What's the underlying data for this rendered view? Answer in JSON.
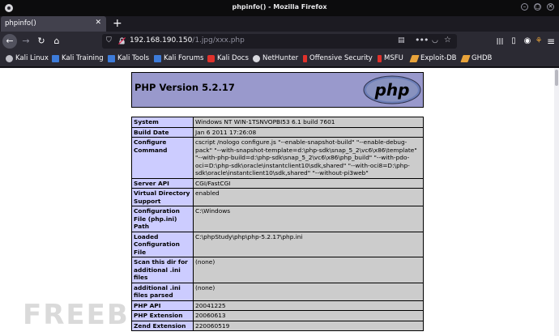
{
  "window": {
    "title": "phpinfo() - Mozilla Firefox",
    "min_glyph": "–",
    "max_glyph": "▢",
    "close_glyph": "✕"
  },
  "tabs": [
    {
      "label": "phpinfo()",
      "close_glyph": "✕"
    }
  ],
  "newtab_glyph": "+",
  "nav": {
    "back_glyph": "←",
    "forward_glyph": "→",
    "reload_glyph": "↻",
    "home_glyph": "⌂",
    "url_host": "192.168.190.150",
    "url_path": "/1.jpg/xxx.php",
    "shield_glyph": "⛉",
    "reader_glyph": "▤",
    "more_glyph": "•••",
    "pocket_glyph": "◡",
    "star_glyph": "☆",
    "library_glyph": "|||",
    "sidebar_glyph": "▯",
    "account_glyph": "◉",
    "extension_glyph": "⚘",
    "menu_glyph": "≡"
  },
  "bookmarks": [
    {
      "label": "Kali Linux",
      "icon": "kali-dragon-icon"
    },
    {
      "label": "Kali Training",
      "icon": "kali-training-icon"
    },
    {
      "label": "Kali Tools",
      "icon": "kali-tools-icon"
    },
    {
      "label": "Kali Forums",
      "icon": "kali-forums-icon"
    },
    {
      "label": "Kali Docs",
      "icon": "kali-docs-icon"
    },
    {
      "label": "NetHunter",
      "icon": "nethunter-icon"
    },
    {
      "label": "Offensive Security",
      "icon": "offsec-icon"
    },
    {
      "label": "MSFU",
      "icon": "msfu-icon"
    },
    {
      "label": "Exploit-DB",
      "icon": "exploit-db-icon"
    },
    {
      "label": "GHDB",
      "icon": "ghdb-icon"
    }
  ],
  "phpinfo": {
    "version": "PHP Version 5.2.17",
    "logo_text": "php",
    "rows": [
      {
        "key": "System",
        "value": "Windows NT WIN-1TSNVOPBI53 6.1 build 7601"
      },
      {
        "key": "Build Date",
        "value": "Jan 6 2011 17:26:08"
      },
      {
        "key": "Configure Command",
        "value": "cscript /nologo configure.js \"--enable-snapshot-build\" \"--enable-debug-pack\" \"--with-snapshot-template=d:\\php-sdk\\snap_5_2\\vc6\\x86\\template\" \"--with-php-build=d:\\php-sdk\\snap_5_2\\vc6\\x86\\php_build\" \"--with-pdo-oci=D:\\php-sdk\\oracle\\instantclient10\\sdk,shared\" \"--with-oci8=D:\\php-sdk\\oracle\\instantclient10\\sdk,shared\" \"--without-pi3web\""
      },
      {
        "key": "Server API",
        "value": "CGI/FastCGI"
      },
      {
        "key": "Virtual Directory Support",
        "value": "enabled"
      },
      {
        "key": "Configuration File (php.ini) Path",
        "value": "C:\\Windows"
      },
      {
        "key": "Loaded Configuration File",
        "value": "C:\\phpStudy\\php\\php-5.2.17\\php.ini"
      },
      {
        "key": "Scan this dir for additional .ini files",
        "value": "(none)"
      },
      {
        "key": "additional .ini files parsed",
        "value": "(none)"
      },
      {
        "key": "PHP API",
        "value": "20041225"
      },
      {
        "key": "PHP Extension",
        "value": "20060613"
      },
      {
        "key": "Zend Extension",
        "value": "220060519"
      }
    ]
  },
  "watermark": "FREEB"
}
